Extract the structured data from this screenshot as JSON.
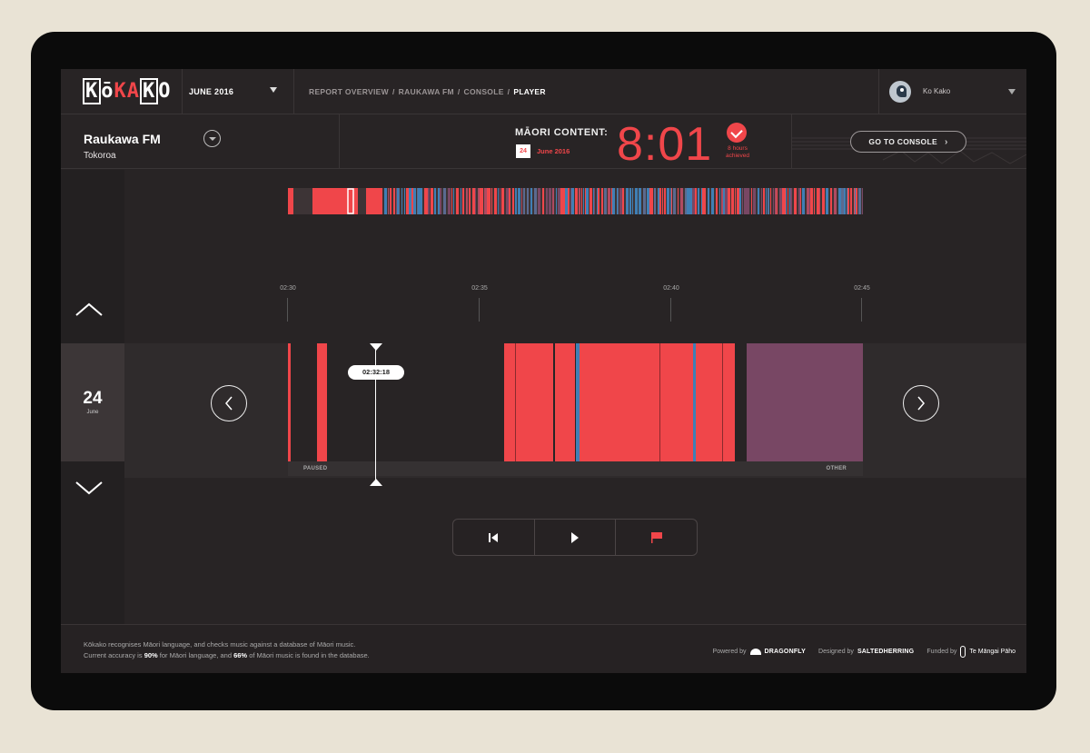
{
  "header": {
    "logo": "KōKAKO",
    "month": "JUNE 2016",
    "breadcrumbs": [
      "REPORT OVERVIEW",
      "RAUKAWA FM",
      "CONSOLE",
      "PLAYER"
    ],
    "user": "Ko Kako"
  },
  "station": {
    "name": "Raukawa FM",
    "location": "Tokoroa"
  },
  "summary": {
    "label": "MĀORI CONTENT:",
    "day": "24",
    "month": "June 2016",
    "time": "8:01",
    "achieved_line1": "8 hours",
    "achieved_line2": "achieved",
    "console_button": "GO TO CONSOLE"
  },
  "rail": {
    "day": "24",
    "month": "June"
  },
  "timeline": {
    "ticks": [
      "02:30",
      "02:35",
      "02:40",
      "02:45"
    ],
    "playhead_time": "02:32:18",
    "label_left": "PAUSED",
    "label_right": "OTHER",
    "colors": {
      "maori": "#f0464a",
      "music": "#3f7fb5",
      "other": "#784764",
      "paused": "#282425"
    }
  },
  "controls": {
    "buttons": [
      "skip-back-icon",
      "play-icon",
      "flag-icon"
    ],
    "flag_color": "#f0464a"
  },
  "footer": {
    "line1": "Kōkako recognises Māori language, and checks music against a database of Māori music.",
    "line2_a": "Current accuracy is ",
    "line2_b": "90%",
    "line2_c": " for Māori language, and ",
    "line2_d": "66%",
    "line2_e": " of Māori music is found in the database.",
    "powered_label": "Powered by",
    "powered_brand": "DRAGONFLY",
    "designed_label": "Designed by",
    "designed_brand": "SALTEDHERRING",
    "funded_label": "Funded by",
    "funded_brand": "Te Māngai Pāho"
  }
}
